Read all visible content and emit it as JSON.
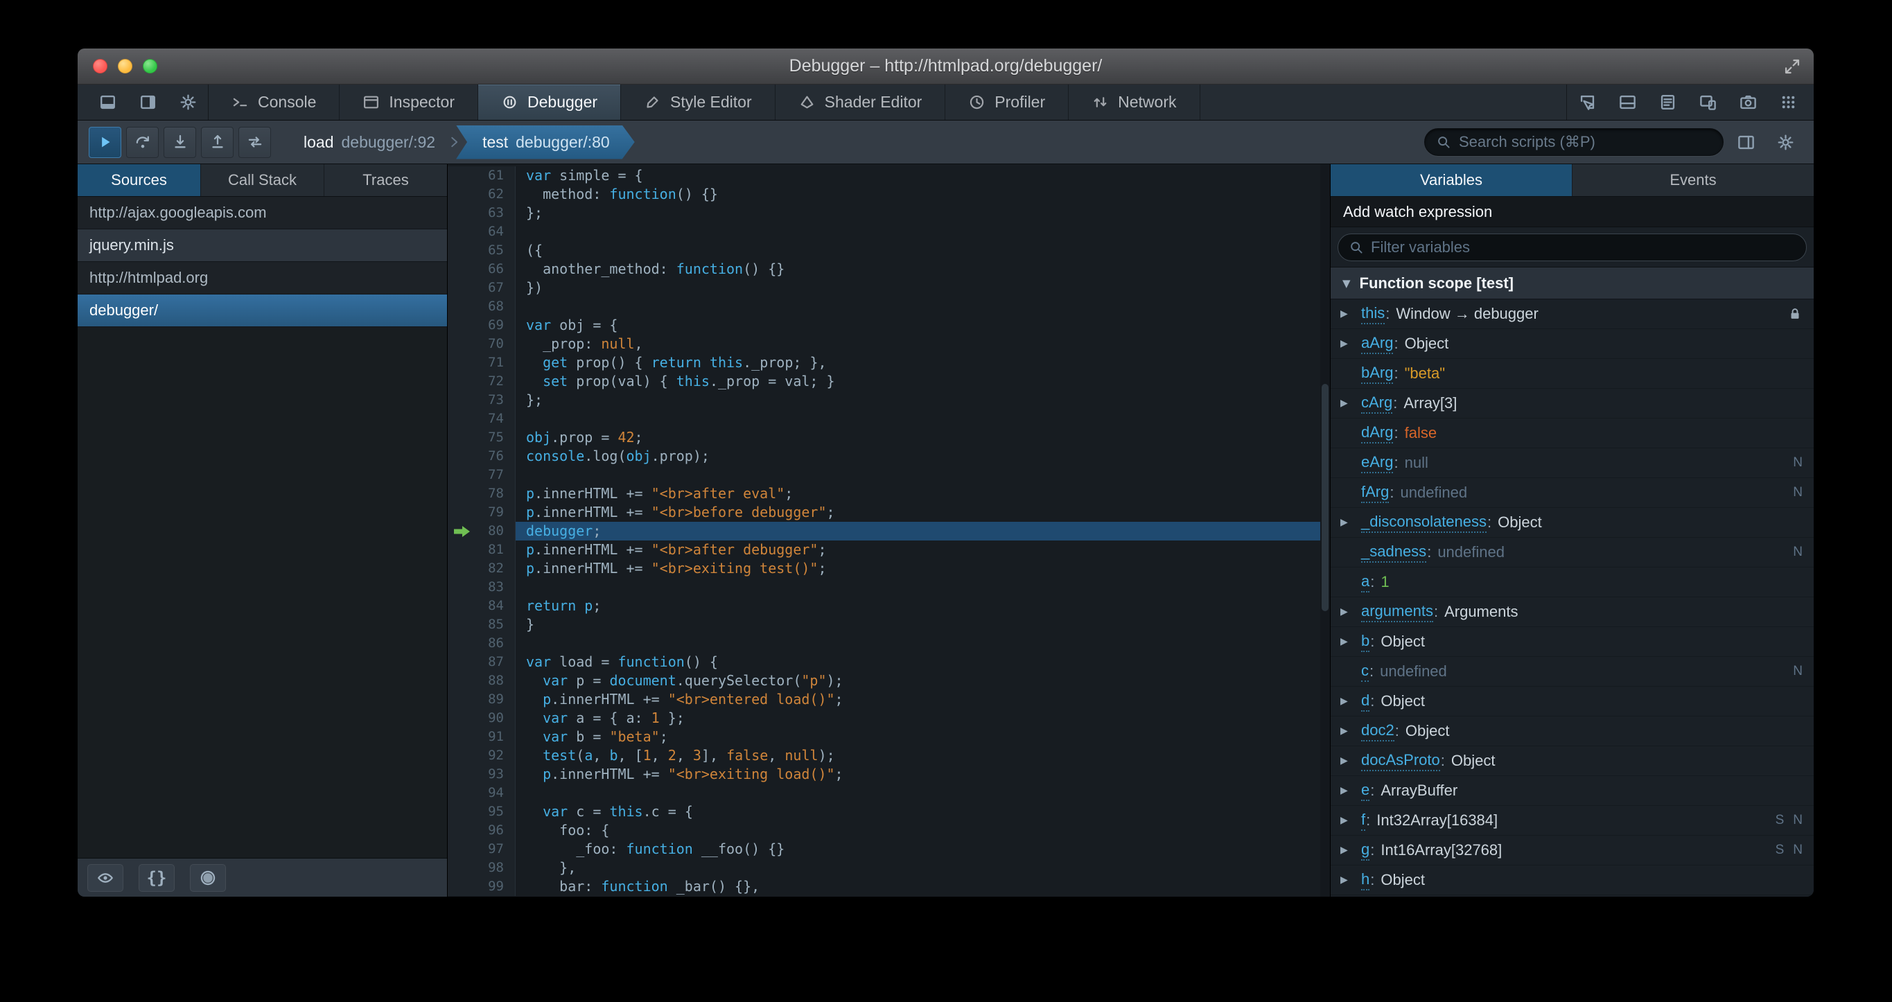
{
  "window": {
    "title": "Debugger – http://htmlpad.org/debugger/"
  },
  "toolbox": {
    "left_buttons": [
      {
        "name": "dock-toolbox-bottom-button",
        "icon": "dock-bottom-icon"
      },
      {
        "name": "dock-toolbox-side-button",
        "icon": "dock-side-icon"
      },
      {
        "name": "toolbox-options-button",
        "icon": "gear-icon"
      }
    ],
    "tabs": [
      {
        "label": "Console",
        "icon": "console-icon",
        "active": false
      },
      {
        "label": "Inspector",
        "icon": "inspector-icon",
        "active": false
      },
      {
        "label": "Debugger",
        "icon": "debugger-icon",
        "active": true
      },
      {
        "label": "Style Editor",
        "icon": "style-editor-icon",
        "active": false
      },
      {
        "label": "Shader Editor",
        "icon": "shader-editor-icon",
        "active": false
      },
      {
        "label": "Profiler",
        "icon": "profiler-icon",
        "active": false
      },
      {
        "label": "Network",
        "icon": "network-icon",
        "active": false
      }
    ],
    "right_buttons": [
      {
        "name": "pick-element-button",
        "icon": "pick-element-icon"
      },
      {
        "name": "split-console-button",
        "icon": "split-console-icon"
      },
      {
        "name": "scratchpad-button",
        "icon": "scratchpad-icon"
      },
      {
        "name": "responsive-mode-button",
        "icon": "responsive-mode-icon"
      },
      {
        "name": "screenshot-button",
        "icon": "screenshot-icon"
      },
      {
        "name": "app-manager-button",
        "icon": "app-grid-icon"
      }
    ]
  },
  "debugger_toolbar": {
    "buttons": [
      {
        "name": "resume-button",
        "icon": "resume-icon",
        "active": true
      },
      {
        "name": "step-over-button",
        "icon": "step-over-icon",
        "active": false
      },
      {
        "name": "step-in-button",
        "icon": "step-in-icon",
        "active": false
      },
      {
        "name": "step-out-button",
        "icon": "step-out-icon",
        "active": false
      },
      {
        "name": "tracer-button",
        "icon": "tracer-icon",
        "active": false
      }
    ],
    "breadcrumbs": [
      {
        "source": "load",
        "location": "debugger/:92",
        "selected": false
      },
      {
        "source": "test",
        "location": "debugger/:80",
        "selected": true
      }
    ],
    "search_placeholder": "Search scripts (⌘P)"
  },
  "sources_panel": {
    "tabs": [
      {
        "label": "Sources",
        "active": true
      },
      {
        "label": "Call Stack",
        "active": false
      },
      {
        "label": "Traces",
        "active": false
      }
    ],
    "items": [
      {
        "label": "http://ajax.googleapis.com",
        "type": "domain",
        "selected": false
      },
      {
        "label": "jquery.min.js",
        "type": "file",
        "selected": false
      },
      {
        "label": "http://htmlpad.org",
        "type": "domain",
        "selected": false
      },
      {
        "label": "debugger/",
        "type": "file",
        "selected": true
      }
    ],
    "footer_buttons": [
      {
        "name": "blackbox-source-button",
        "icon": "eye-icon"
      },
      {
        "name": "pretty-print-button",
        "icon": "pretty-print-icon"
      },
      {
        "name": "pause-on-exceptions-button",
        "icon": "blackbox-icon"
      }
    ]
  },
  "editor": {
    "current_line": 80,
    "lines": [
      {
        "n": 61,
        "t": [
          [
            "k",
            "var"
          ],
          [
            "p",
            " simple = {"
          ]
        ]
      },
      {
        "n": 62,
        "t": [
          [
            "p",
            "  method: "
          ],
          [
            "k",
            "function"
          ],
          [
            "p",
            "() {}"
          ]
        ]
      },
      {
        "n": 63,
        "t": [
          [
            "p",
            "};"
          ]
        ]
      },
      {
        "n": 64,
        "t": []
      },
      {
        "n": 65,
        "t": [
          [
            "p",
            "({"
          ]
        ]
      },
      {
        "n": 66,
        "t": [
          [
            "p",
            "  another_method: "
          ],
          [
            "k",
            "function"
          ],
          [
            "p",
            "() {}"
          ]
        ]
      },
      {
        "n": 67,
        "t": [
          [
            "p",
            "})"
          ]
        ]
      },
      {
        "n": 68,
        "t": []
      },
      {
        "n": 69,
        "t": [
          [
            "k",
            "var"
          ],
          [
            "p",
            " obj = {"
          ]
        ]
      },
      {
        "n": 70,
        "t": [
          [
            "p",
            "  _prop: "
          ],
          [
            "a",
            "null"
          ],
          [
            "p",
            ","
          ]
        ]
      },
      {
        "n": 71,
        "t": [
          [
            "p",
            "  "
          ],
          [
            "k",
            "get"
          ],
          [
            "p",
            " prop() { "
          ],
          [
            "k",
            "return"
          ],
          [
            "p",
            " "
          ],
          [
            "k",
            "this"
          ],
          [
            "p",
            "._prop; },"
          ]
        ]
      },
      {
        "n": 72,
        "t": [
          [
            "p",
            "  "
          ],
          [
            "k",
            "set"
          ],
          [
            "p",
            " prop(val) { "
          ],
          [
            "k",
            "this"
          ],
          [
            "p",
            "._prop = val; }"
          ]
        ]
      },
      {
        "n": 73,
        "t": [
          [
            "p",
            "};"
          ]
        ]
      },
      {
        "n": 74,
        "t": []
      },
      {
        "n": 75,
        "t": [
          [
            "v",
            "obj"
          ],
          [
            "p",
            ".prop = "
          ],
          [
            "n",
            "42"
          ],
          [
            "p",
            ";"
          ]
        ]
      },
      {
        "n": 76,
        "t": [
          [
            "v",
            "console"
          ],
          [
            "p",
            ".log("
          ],
          [
            "v",
            "obj"
          ],
          [
            "p",
            ".prop);"
          ]
        ]
      },
      {
        "n": 77,
        "t": []
      },
      {
        "n": 78,
        "t": [
          [
            "v",
            "p"
          ],
          [
            "p",
            ".innerHTML += "
          ],
          [
            "s",
            "\"<br>after eval\""
          ],
          [
            "p",
            ";"
          ]
        ]
      },
      {
        "n": 79,
        "t": [
          [
            "v",
            "p"
          ],
          [
            "p",
            ".innerHTML += "
          ],
          [
            "s",
            "\"<br>before debugger\""
          ],
          [
            "p",
            ";"
          ]
        ]
      },
      {
        "n": 80,
        "t": [
          [
            "k",
            "debugger"
          ],
          [
            "p",
            ";"
          ]
        ]
      },
      {
        "n": 81,
        "t": [
          [
            "v",
            "p"
          ],
          [
            "p",
            ".innerHTML += "
          ],
          [
            "s",
            "\"<br>after debugger\""
          ],
          [
            "p",
            ";"
          ]
        ]
      },
      {
        "n": 82,
        "t": [
          [
            "v",
            "p"
          ],
          [
            "p",
            ".innerHTML += "
          ],
          [
            "s",
            "\"<br>exiting test()\""
          ],
          [
            "p",
            ";"
          ]
        ]
      },
      {
        "n": 83,
        "t": []
      },
      {
        "n": 84,
        "t": [
          [
            "k",
            "return"
          ],
          [
            "p",
            " "
          ],
          [
            "v",
            "p"
          ],
          [
            "p",
            ";"
          ]
        ]
      },
      {
        "n": 85,
        "t": [
          [
            "p",
            "}"
          ]
        ]
      },
      {
        "n": 86,
        "t": []
      },
      {
        "n": 87,
        "t": [
          [
            "k",
            "var"
          ],
          [
            "p",
            " load = "
          ],
          [
            "k",
            "function"
          ],
          [
            "p",
            "() {"
          ]
        ]
      },
      {
        "n": 88,
        "t": [
          [
            "p",
            "  "
          ],
          [
            "k",
            "var"
          ],
          [
            "p",
            " p = "
          ],
          [
            "v",
            "document"
          ],
          [
            "p",
            ".querySelector("
          ],
          [
            "s",
            "\"p\""
          ],
          [
            "p",
            ");"
          ]
        ]
      },
      {
        "n": 89,
        "t": [
          [
            "p",
            "  "
          ],
          [
            "v",
            "p"
          ],
          [
            "p",
            ".innerHTML += "
          ],
          [
            "s",
            "\"<br>entered load()\""
          ],
          [
            "p",
            ";"
          ]
        ]
      },
      {
        "n": 90,
        "t": [
          [
            "p",
            "  "
          ],
          [
            "k",
            "var"
          ],
          [
            "p",
            " a = { a: "
          ],
          [
            "n",
            "1"
          ],
          [
            "p",
            " };"
          ]
        ]
      },
      {
        "n": 91,
        "t": [
          [
            "p",
            "  "
          ],
          [
            "k",
            "var"
          ],
          [
            "p",
            " b = "
          ],
          [
            "s",
            "\"beta\""
          ],
          [
            "p",
            ";"
          ]
        ]
      },
      {
        "n": 92,
        "t": [
          [
            "p",
            "  "
          ],
          [
            "v",
            "test"
          ],
          [
            "p",
            "("
          ],
          [
            "v",
            "a"
          ],
          [
            "p",
            ", "
          ],
          [
            "v",
            "b"
          ],
          [
            "p",
            ", ["
          ],
          [
            "n",
            "1"
          ],
          [
            "p",
            ", "
          ],
          [
            "n",
            "2"
          ],
          [
            "p",
            ", "
          ],
          [
            "n",
            "3"
          ],
          [
            "p",
            "], "
          ],
          [
            "a",
            "false"
          ],
          [
            "p",
            ", "
          ],
          [
            "a",
            "null"
          ],
          [
            "p",
            ");"
          ]
        ]
      },
      {
        "n": 93,
        "t": [
          [
            "p",
            "  "
          ],
          [
            "v",
            "p"
          ],
          [
            "p",
            ".innerHTML += "
          ],
          [
            "s",
            "\"<br>exiting load()\""
          ],
          [
            "p",
            ";"
          ]
        ]
      },
      {
        "n": 94,
        "t": []
      },
      {
        "n": 95,
        "t": [
          [
            "p",
            "  "
          ],
          [
            "k",
            "var"
          ],
          [
            "p",
            " c = "
          ],
          [
            "k",
            "this"
          ],
          [
            "p",
            ".c = {"
          ]
        ]
      },
      {
        "n": 96,
        "t": [
          [
            "p",
            "    foo: {"
          ]
        ]
      },
      {
        "n": 97,
        "t": [
          [
            "p",
            "      _foo: "
          ],
          [
            "k",
            "function"
          ],
          [
            "p",
            " __foo() {}"
          ]
        ]
      },
      {
        "n": 98,
        "t": [
          [
            "p",
            "    },"
          ]
        ]
      },
      {
        "n": 99,
        "t": [
          [
            "p",
            "    bar: "
          ],
          [
            "k",
            "function"
          ],
          [
            "p",
            " _bar() {},"
          ]
        ]
      }
    ]
  },
  "variables_panel": {
    "tabs": [
      {
        "label": "Variables",
        "active": true
      },
      {
        "label": "Events",
        "active": false
      }
    ],
    "watch_label": "Add watch expression",
    "filter_placeholder": "Filter variables",
    "scope": {
      "label": "Function scope [test]",
      "expanded": true
    },
    "variables": [
      {
        "name": "this",
        "value": "Window → debugger",
        "type": "object",
        "expandable": true,
        "lock": true
      },
      {
        "name": "aArg",
        "value": "Object",
        "type": "object",
        "expandable": true
      },
      {
        "name": "bArg",
        "value": "\"beta\"",
        "type": "string",
        "expandable": false
      },
      {
        "name": "cArg",
        "value": "Array[3]",
        "type": "object",
        "expandable": true
      },
      {
        "name": "dArg",
        "value": "false",
        "type": "boolean",
        "expandable": false
      },
      {
        "name": "eArg",
        "value": "null",
        "type": "null",
        "expandable": false,
        "badges": [
          "N"
        ]
      },
      {
        "name": "fArg",
        "value": "undefined",
        "type": "undefined",
        "expandable": false,
        "badges": [
          "N"
        ]
      },
      {
        "name": "_disconsolateness",
        "value": "Object",
        "type": "object",
        "expandable": true
      },
      {
        "name": "_sadness",
        "value": "undefined",
        "type": "undefined",
        "expandable": false,
        "badges": [
          "N"
        ]
      },
      {
        "name": "a",
        "value": "1",
        "type": "number",
        "expandable": false
      },
      {
        "name": "arguments",
        "value": "Arguments",
        "type": "object",
        "expandable": true
      },
      {
        "name": "b",
        "value": "Object",
        "type": "object",
        "expandable": true
      },
      {
        "name": "c",
        "value": "undefined",
        "type": "undefined",
        "expandable": false,
        "badges": [
          "N"
        ]
      },
      {
        "name": "d",
        "value": "Object",
        "type": "object",
        "expandable": true
      },
      {
        "name": "doc2",
        "value": "Object",
        "type": "object",
        "expandable": true
      },
      {
        "name": "docAsProto",
        "value": "Object",
        "type": "object",
        "expandable": true
      },
      {
        "name": "e",
        "value": "ArrayBuffer",
        "type": "object",
        "expandable": true
      },
      {
        "name": "f",
        "value": "Int32Array[16384]",
        "type": "object",
        "expandable": true,
        "badges": [
          "S",
          "N"
        ]
      },
      {
        "name": "g",
        "value": "Int16Array[32768]",
        "type": "object",
        "expandable": true,
        "badges": [
          "S",
          "N"
        ]
      },
      {
        "name": "h",
        "value": "Object",
        "type": "object",
        "expandable": true
      }
    ]
  },
  "colors": {
    "selection_blue": "#1d4f73",
    "highlight_blue": "#46afe3",
    "highlight_orange": "#d96629",
    "highlight_light_orange": "#d99b28",
    "highlight_green": "#70bf53",
    "toolbar_background": "#343c45",
    "tab_toolbar_background": "#252c33",
    "editor_background": "#171c21"
  }
}
